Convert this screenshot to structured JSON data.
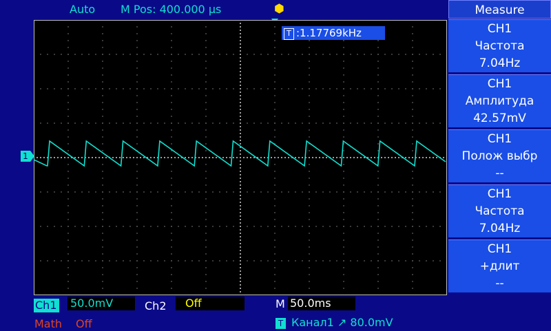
{
  "top_bar": {
    "run_mode": "Auto",
    "position": "M Pos: 400.000 µs",
    "usb_icon": "usb-icon"
  },
  "frequency_counter": {
    "badge": "T",
    "value": ":1.17769kHz"
  },
  "trace": {
    "channel_marker": "1",
    "color": "#10e0d0",
    "waveform": "sawtooth",
    "periods_visible": 11
  },
  "measure_panel": {
    "title": "Measure",
    "items": [
      {
        "channel": "CH1",
        "name": "Частота",
        "value": "7.04Hz"
      },
      {
        "channel": "CH1",
        "name": "Амплитуда",
        "value": "42.57mV"
      },
      {
        "channel": "CH1",
        "name": "Полож выбр",
        "value": "--"
      },
      {
        "channel": "CH1",
        "name": "Частота",
        "value": "7.04Hz"
      },
      {
        "channel": "CH1",
        "name": "+длит",
        "value": "--"
      }
    ]
  },
  "bottom": {
    "ch1_label": "Ch1",
    "ch1_scale": "50.0mV",
    "ch2_label": "Ch2",
    "ch2_scale": "Off",
    "m_label": "M",
    "m_scale": "50.0ms",
    "math_label": "Math",
    "math_value": "Off",
    "trigger_badge": "T",
    "trigger_info": "Канал1 ↗ 80.0mV"
  },
  "colors": {
    "background": "#0a0a88",
    "screen": "#000000",
    "ch1": "#10e0d0",
    "panel": "#1a4ee6",
    "math": "#dd4422",
    "usb": "#ffd800"
  }
}
